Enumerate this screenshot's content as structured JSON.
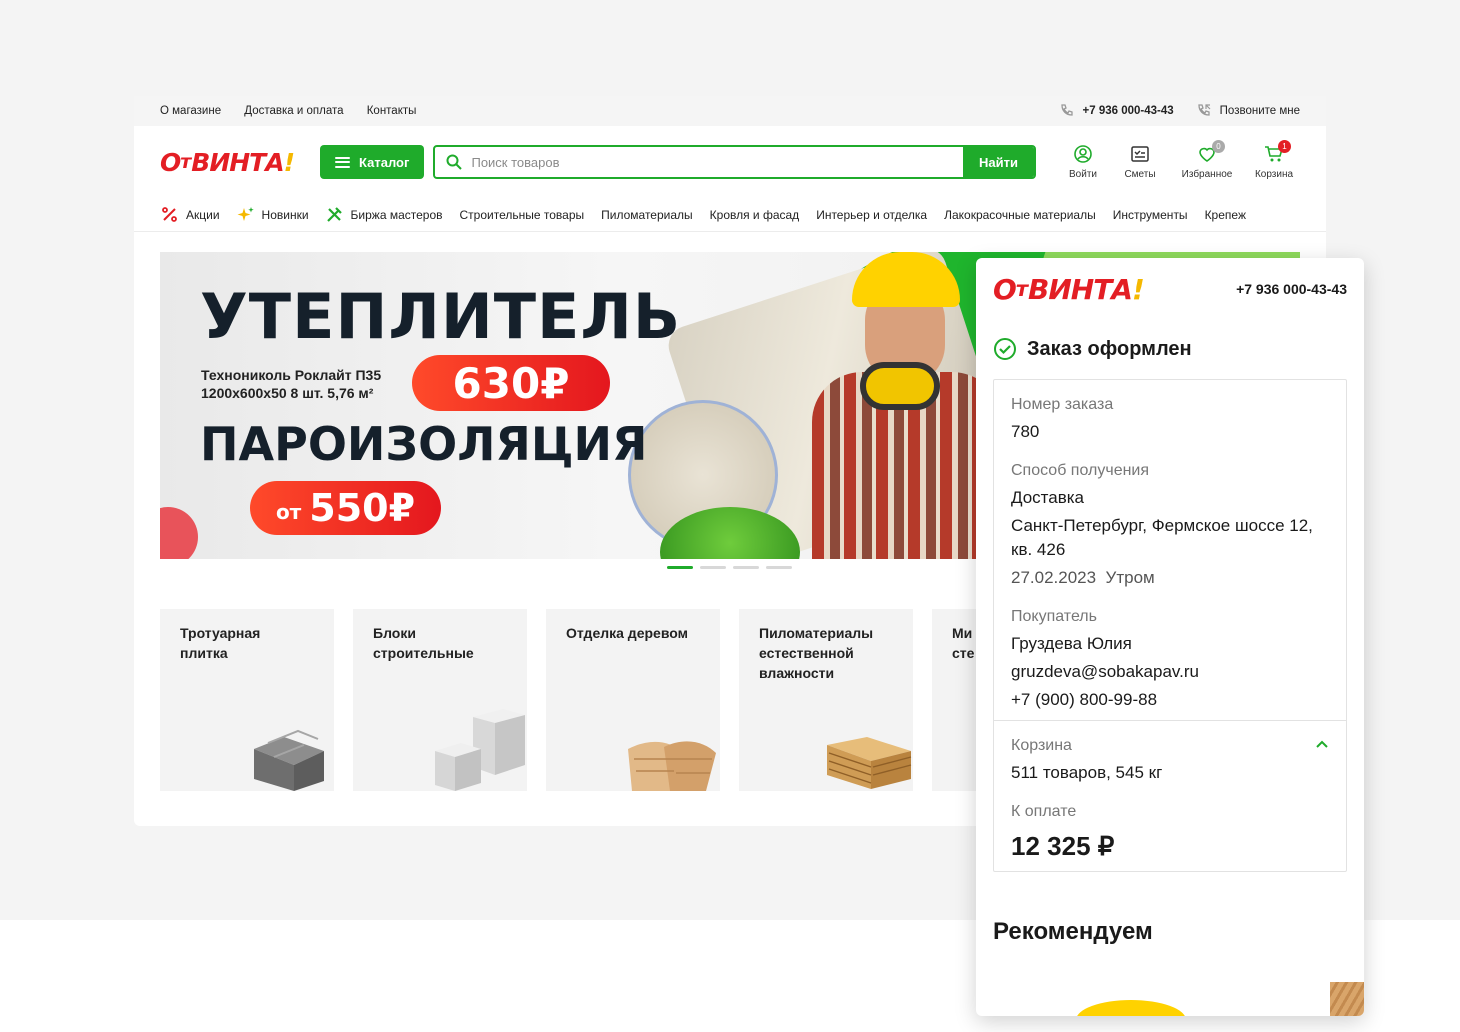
{
  "topbar": {
    "links": [
      "О магазине",
      "Доставка и оплата",
      "Контакты"
    ],
    "phone": "+7 936 000-43-43",
    "callback": "Позвоните мне"
  },
  "logo": {
    "o": "О",
    "t": "т",
    "main": "ВИНТА",
    "mark": "!"
  },
  "header": {
    "catalog_label": "Каталог",
    "search_placeholder": "Поиск товаров",
    "search_button": "Найти",
    "icons": {
      "login": "Войти",
      "estimates": "Сметы",
      "favorites": "Избранное",
      "favorites_count": "0",
      "cart": "Корзина",
      "cart_count": "1"
    }
  },
  "nav": [
    "Акции",
    "Новинки",
    "Биржа мастеров",
    "Строительные товары",
    "Пиломатериалы",
    "Кровля и фасад",
    "Интерьер и отделка",
    "Лакокрасочные материалы",
    "Инструменты",
    "Крепеж"
  ],
  "banner": {
    "title1": "УТЕПЛИТЕЛЬ",
    "subtitle_line1": "Технониколь Роклайт П35",
    "subtitle_line2": "1200x600x50 8 шт. 5,76 м²",
    "price1": "630₽",
    "title2": "ПАРОИЗОЛЯЦИЯ",
    "price2_prefix": "от",
    "price2": "550₽"
  },
  "categories": [
    "Тротуарная плитка",
    "Блоки строительные",
    "Отделка деревом",
    "Пиломатериалы естественной влажности",
    "Ми сте"
  ],
  "modal": {
    "phone": "+7 936 000-43-43",
    "status": "Заказ оформлен",
    "order_label": "Номер заказа",
    "order_number": "780",
    "delivery_label": "Способ получения",
    "delivery_method": "Доставка",
    "address": "Санкт-Петербург, Фермское шоссе 12, кв. 426",
    "date_time": "27.02.2023  Утром",
    "buyer_label": "Покупатель",
    "buyer_name": "Груздева Юлия",
    "buyer_email": "gruzdeva@sobakapav.ru",
    "buyer_phone": "+7 (900) 800-99-88",
    "cart_label": "Корзина",
    "cart_summary": "511 товаров, 545 кг",
    "pay_label": "К оплате",
    "total": "12 325 ₽",
    "recommend": "Рекомендуем"
  },
  "colors": {
    "accent": "#1fab2b",
    "brand_red": "#e31e24",
    "brand_yellow": "#f5b800"
  }
}
